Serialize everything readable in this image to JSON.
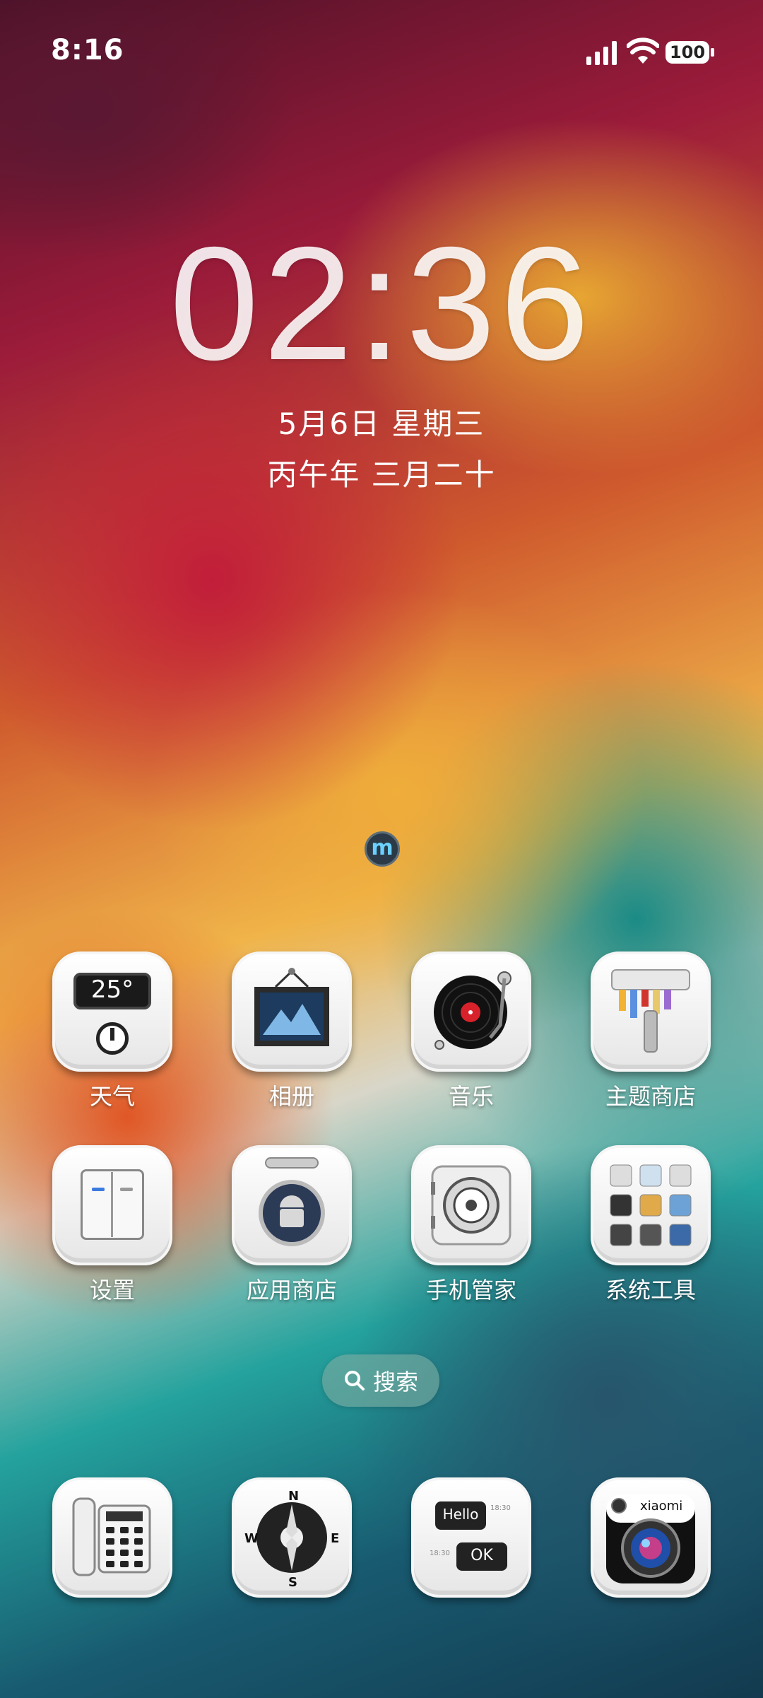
{
  "status_bar": {
    "time": "8:16",
    "battery": "100"
  },
  "lock_clock": {
    "time": "02:36",
    "date": "5月6日 星期三",
    "lunar": "丙午年 三月二十"
  },
  "apps": [
    {
      "label": "天气",
      "icon": "weather-icon",
      "temp": "25°"
    },
    {
      "label": "相册",
      "icon": "gallery-icon"
    },
    {
      "label": "音乐",
      "icon": "music-icon"
    },
    {
      "label": "主题商店",
      "icon": "themes-icon"
    },
    {
      "label": "设置",
      "icon": "settings-icon"
    },
    {
      "label": "应用商店",
      "icon": "app-store-icon"
    },
    {
      "label": "手机管家",
      "icon": "security-icon"
    },
    {
      "label": "系统工具",
      "icon": "tools-icon"
    }
  ],
  "search": {
    "label": "搜索"
  },
  "dock": [
    {
      "icon": "phone-icon"
    },
    {
      "icon": "compass-icon",
      "letters": [
        "N",
        "W",
        "E",
        "S"
      ]
    },
    {
      "icon": "messages-icon",
      "hello": "Hello",
      "ok": "OK",
      "t1": "18:30",
      "t2": "18:30"
    },
    {
      "icon": "camera-icon",
      "brand": "xiaomi"
    }
  ]
}
